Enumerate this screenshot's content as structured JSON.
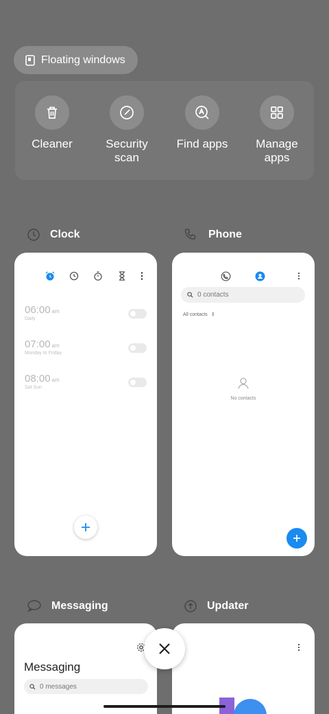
{
  "floating_windows": {
    "label": "Floating windows"
  },
  "quick_actions": [
    {
      "label": "Cleaner",
      "icon": "trash-icon"
    },
    {
      "label": "Security\nscan",
      "icon": "security-scan-icon"
    },
    {
      "label": "Find apps",
      "icon": "find-apps-icon"
    },
    {
      "label": "Manage\napps",
      "icon": "grid-icon"
    }
  ],
  "apps": {
    "clock": {
      "name": "Clock",
      "alarms": [
        {
          "time": "06:00",
          "ampm": "am",
          "repeat": "Daily"
        },
        {
          "time": "07:00",
          "ampm": "am",
          "repeat": "Monday to Friday"
        },
        {
          "time": "08:00",
          "ampm": "am",
          "repeat": "Sat Sun"
        }
      ]
    },
    "phone": {
      "name": "Phone",
      "search_placeholder": "0 contacts",
      "filter": "All contacts",
      "empty": "No contacts"
    },
    "messaging": {
      "name": "Messaging",
      "title": "Messaging",
      "search_placeholder": "0 messages"
    },
    "updater": {
      "name": "Updater"
    }
  },
  "colors": {
    "background": "#6e6e6e",
    "accent_blue": "#1a8bf0"
  }
}
